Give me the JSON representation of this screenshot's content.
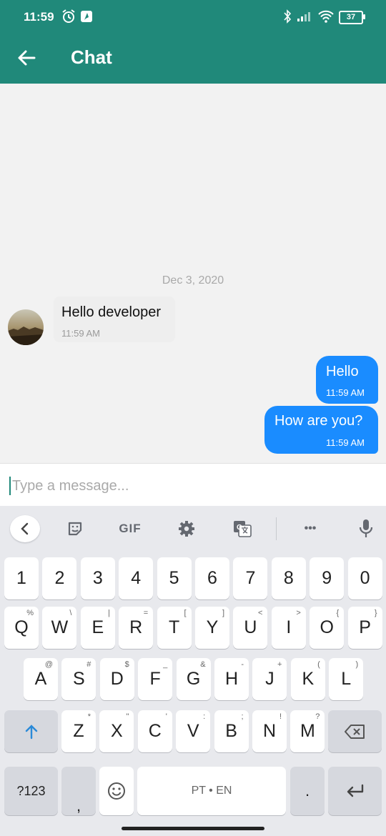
{
  "status": {
    "time": "11:59",
    "battery": "37"
  },
  "appbar": {
    "title": "Chat"
  },
  "chat": {
    "date": "Dec 3, 2020",
    "incoming": [
      {
        "text": "Hello developer",
        "time": "11:59 AM"
      }
    ],
    "outgoing": [
      {
        "text": "Hello",
        "time": "11:59 AM"
      },
      {
        "text": "How are you?",
        "time": "11:59 AM"
      }
    ]
  },
  "composer": {
    "placeholder": "Type a message..."
  },
  "keyboard": {
    "toolbar": {
      "gif": "GIF",
      "more": "•••"
    },
    "row1": [
      "1",
      "2",
      "3",
      "4",
      "5",
      "6",
      "7",
      "8",
      "9",
      "0"
    ],
    "row2": [
      {
        "k": "Q",
        "h": "%"
      },
      {
        "k": "W",
        "h": "\\"
      },
      {
        "k": "E",
        "h": "|"
      },
      {
        "k": "R",
        "h": "="
      },
      {
        "k": "T",
        "h": "["
      },
      {
        "k": "Y",
        "h": "]"
      },
      {
        "k": "U",
        "h": "<"
      },
      {
        "k": "I",
        "h": ">"
      },
      {
        "k": "O",
        "h": "{"
      },
      {
        "k": "P",
        "h": "}"
      }
    ],
    "row3": [
      {
        "k": "A",
        "h": "@"
      },
      {
        "k": "S",
        "h": "#"
      },
      {
        "k": "D",
        "h": "$"
      },
      {
        "k": "F",
        "h": "_"
      },
      {
        "k": "G",
        "h": "&"
      },
      {
        "k": "H",
        "h": "-"
      },
      {
        "k": "J",
        "h": "+"
      },
      {
        "k": "K",
        "h": "("
      },
      {
        "k": "L",
        "h": ")"
      }
    ],
    "row4": [
      {
        "k": "Z",
        "h": "*"
      },
      {
        "k": "X",
        "h": "\""
      },
      {
        "k": "C",
        "h": "'"
      },
      {
        "k": "V",
        "h": ":"
      },
      {
        "k": "B",
        "h": ";"
      },
      {
        "k": "N",
        "h": "!"
      },
      {
        "k": "M",
        "h": "?"
      }
    ],
    "bottom": {
      "symbols": "?123",
      "comma": ",",
      "space": "PT • EN",
      "period": "."
    }
  },
  "colors": {
    "accent": "#20897a",
    "outgoing_bubble": "#1a8cff",
    "incoming_bubble": "#eeeeee"
  }
}
